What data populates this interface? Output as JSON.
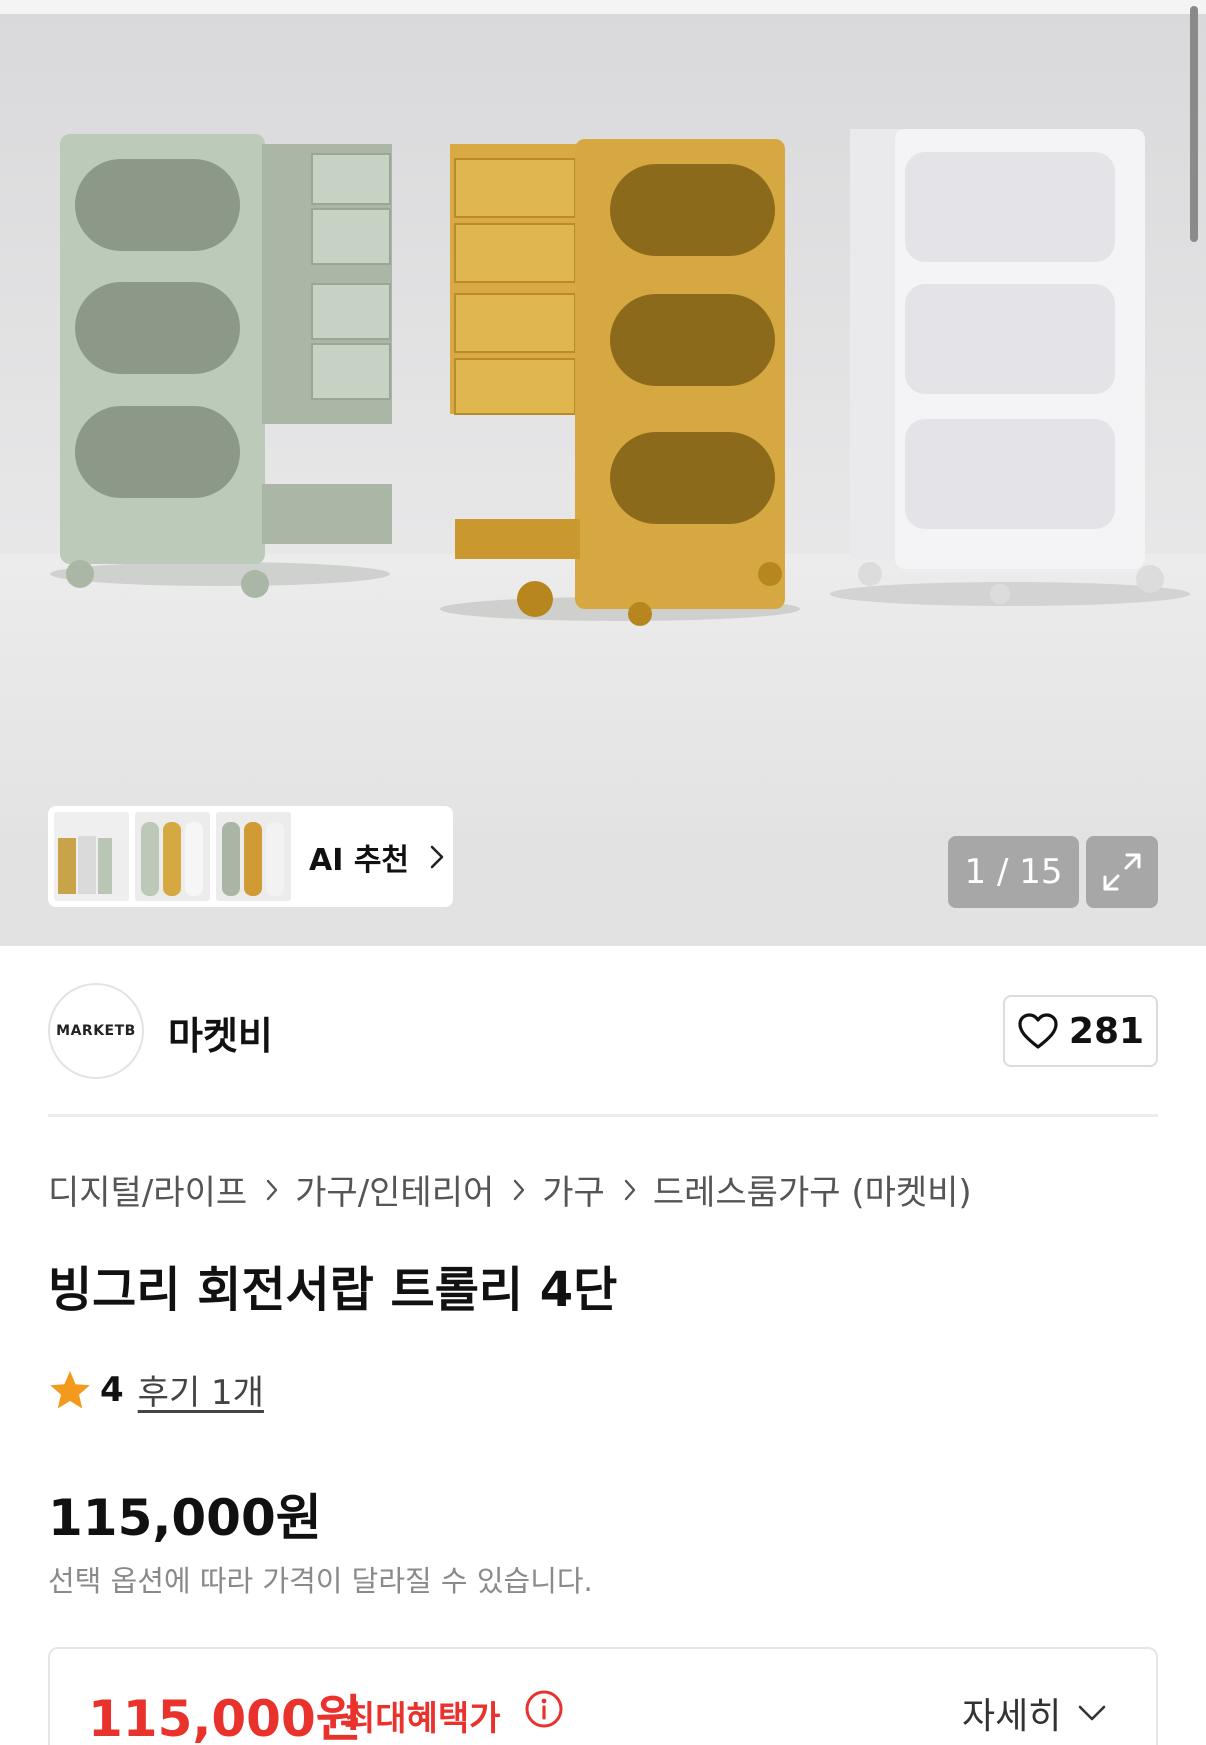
{
  "gallery": {
    "counter": "1 / 15",
    "ai_label": "AI 추천",
    "image_alt": "Three rolling drawer trolleys in sage green, mustard yellow and white"
  },
  "seller": {
    "logo_text": "MARKETB",
    "name": "마켓비",
    "likes": "281"
  },
  "breadcrumb": [
    "디지털/라이프",
    "가구/인테리어",
    "가구",
    "드레스룸가구 (마켓비)"
  ],
  "product": {
    "title": "빙그리 회전서랍 트롤리 4단",
    "rating": "4",
    "review_link": "후기 1개",
    "price": "115,000원",
    "price_note": "선택 옵션에 따라 가격이 달라질 수 있습니다."
  },
  "benefit": {
    "price": "115,000원",
    "label": "최대혜택가",
    "detail": "자세히"
  },
  "colors": {
    "accent_red": "#e8322b",
    "star": "#f39a1e",
    "sage": "#bccab9",
    "mustard": "#d6a842",
    "white_unit": "#f3f3f5"
  },
  "icons": [
    "star-icon",
    "heart-icon",
    "info-icon",
    "chevron-right-icon",
    "chevron-down-icon",
    "expand-icon"
  ]
}
